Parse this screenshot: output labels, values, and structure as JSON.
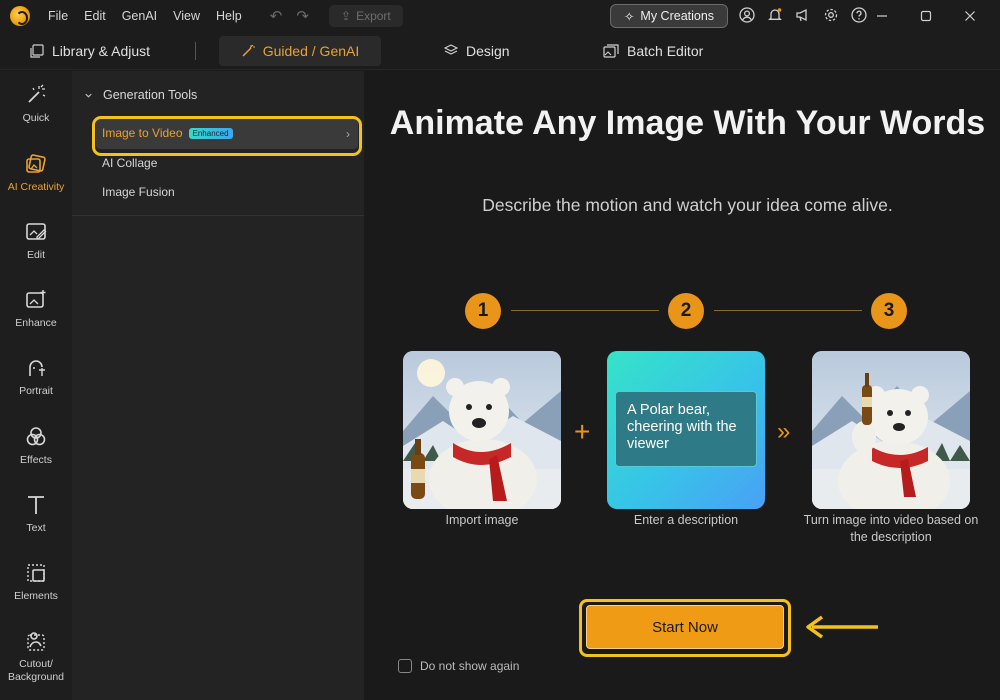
{
  "menu": {
    "file": "File",
    "edit": "Edit",
    "genai": "GenAI",
    "view": "View",
    "help": "Help"
  },
  "toolbar": {
    "export_label": "Export",
    "my_creations_label": "My Creations"
  },
  "tabs": [
    {
      "label": "Library & Adjust"
    },
    {
      "label": "Guided / GenAI"
    },
    {
      "label": "Design"
    },
    {
      "label": "Batch Editor"
    }
  ],
  "rail": [
    {
      "label": "Quick"
    },
    {
      "label": "AI Creativity"
    },
    {
      "label": "Edit"
    },
    {
      "label": "Enhance"
    },
    {
      "label": "Portrait"
    },
    {
      "label": "Effects"
    },
    {
      "label": "Text"
    },
    {
      "label": "Elements"
    },
    {
      "label": "Cutout/\nBackground"
    }
  ],
  "panel": {
    "heading": "Generation Tools",
    "items": [
      {
        "label": "Image to Video",
        "badge": "Enhanced"
      },
      {
        "label": "AI Collage"
      },
      {
        "label": "Image Fusion"
      }
    ]
  },
  "main": {
    "title": "Animate Any Image With Your Words",
    "subtitle": "Describe the motion and watch your idea come alive.",
    "steps": [
      {
        "num": "1",
        "label": "Import image"
      },
      {
        "num": "2",
        "label": "Enter a description"
      },
      {
        "num": "3",
        "label": "Turn image into video based on the description"
      }
    ],
    "description_text": "A Polar bear, cheering with the viewer",
    "start_label": "Start Now",
    "dont_show_label": "Do not show again"
  },
  "colors": {
    "accent": "#e9951a",
    "highlight": "#f4c21b",
    "active_tab_text": "#e9a233"
  }
}
